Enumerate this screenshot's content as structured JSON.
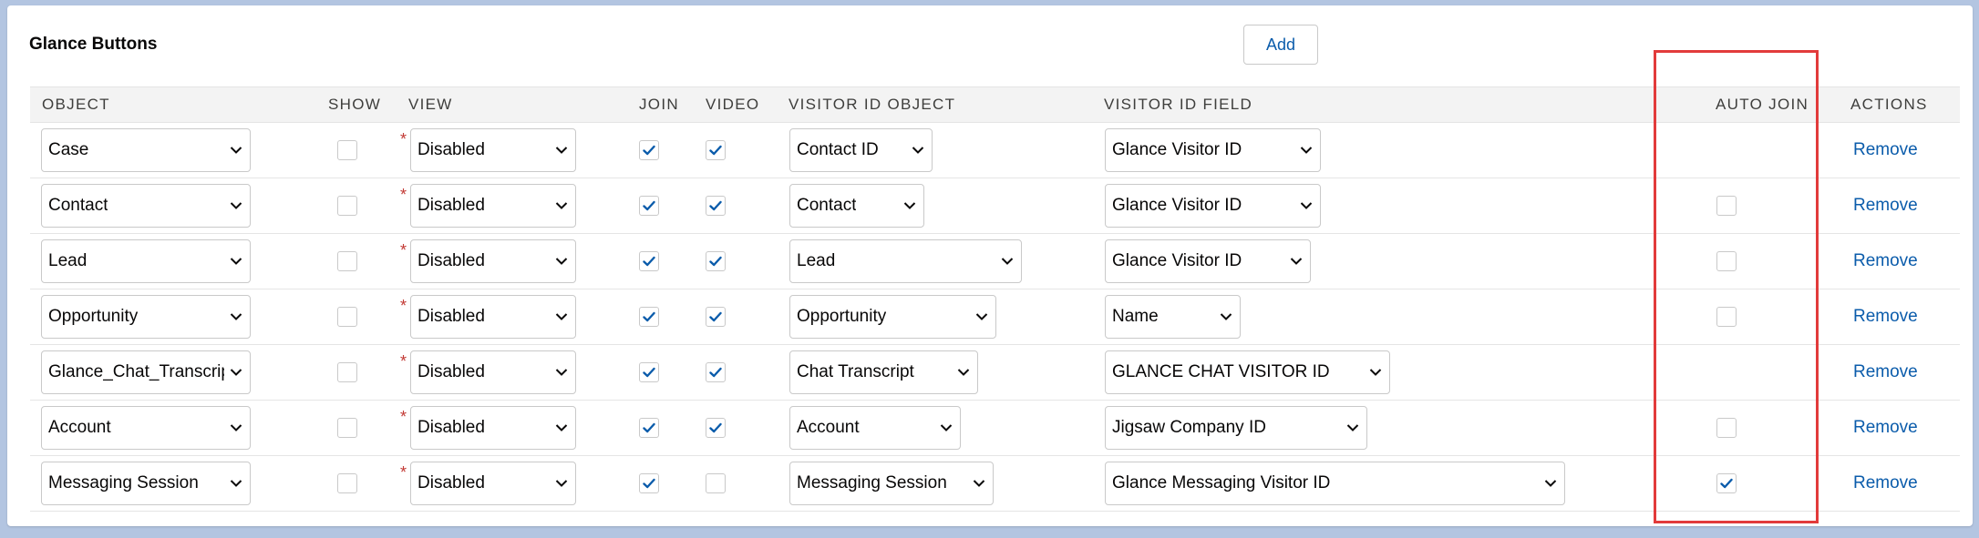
{
  "section_title": "Glance Buttons",
  "add_label": "Add",
  "columns": {
    "object": "OBJECT",
    "show": "SHOW",
    "view": "VIEW",
    "join": "JOIN",
    "video": "VIDEO",
    "visitor_id_object": "VISITOR ID OBJECT",
    "visitor_id_field": "VISITOR ID FIELD",
    "auto_join": "AUTO JOIN",
    "actions": "ACTIONS"
  },
  "required_marker": "*",
  "remove_label": "Remove",
  "highlight_color": "#e23b3b",
  "accent_color": "#0b5cab",
  "rows": [
    {
      "object": "Case",
      "show": false,
      "view": "Disabled",
      "join": true,
      "video": true,
      "visitor_id_object": "Contact ID",
      "visitor_id_field": "Glance Visitor ID",
      "auto_join": null
    },
    {
      "object": "Contact",
      "show": false,
      "view": "Disabled",
      "join": true,
      "video": true,
      "visitor_id_object": "Contact",
      "visitor_id_field": "Glance Visitor ID",
      "auto_join": false
    },
    {
      "object": "Lead",
      "show": false,
      "view": "Disabled",
      "join": true,
      "video": true,
      "visitor_id_object": "Lead",
      "visitor_id_field": "Glance Visitor ID",
      "auto_join": false
    },
    {
      "object": "Opportunity",
      "show": false,
      "view": "Disabled",
      "join": true,
      "video": true,
      "visitor_id_object": "Opportunity",
      "visitor_id_field": "Name",
      "auto_join": false
    },
    {
      "object": "Glance_Chat_Transcript",
      "show": false,
      "view": "Disabled",
      "join": true,
      "video": true,
      "visitor_id_object": "Chat Transcript",
      "visitor_id_field": "GLANCE CHAT VISITOR ID",
      "auto_join": null
    },
    {
      "object": "Account",
      "show": false,
      "view": "Disabled",
      "join": true,
      "video": true,
      "visitor_id_object": "Account",
      "visitor_id_field": "Jigsaw Company ID",
      "auto_join": false
    },
    {
      "object": "Messaging Session",
      "show": false,
      "view": "Disabled",
      "join": true,
      "video": false,
      "visitor_id_object": "Messaging Session",
      "visitor_id_field": "Glance Messaging Visitor ID",
      "auto_join": true
    }
  ]
}
